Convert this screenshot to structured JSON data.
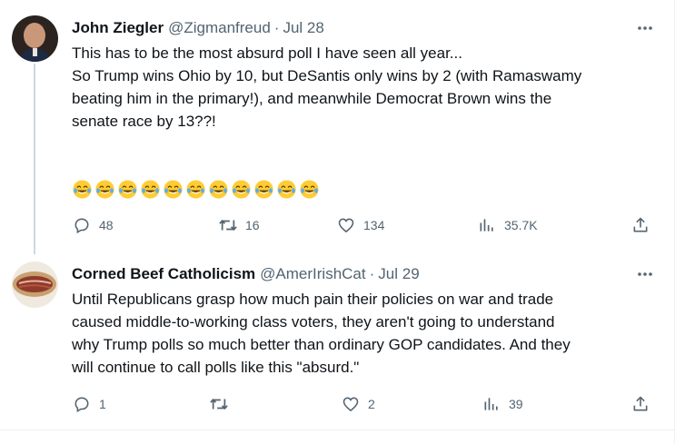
{
  "tweets": [
    {
      "name": "John Ziegler",
      "handle": "@Zigmanfreud",
      "sep": "·",
      "date": "Jul 28",
      "lines": [
        "This has to be the most absurd poll I have seen all year...",
        "",
        "So Trump wins Ohio by 10, but DeSantis only wins by 2 (with Ramaswamy",
        "beating him in the primary!), and meanwhile Democrat Brown wins the",
        "senate race by 13??!"
      ],
      "emoji": "face-with-tears-of-joy",
      "emoji_count": 11,
      "replies": "48",
      "retweets": "16",
      "likes": "134",
      "views": "35.7K"
    },
    {
      "name": "Corned Beef Catholicism",
      "handle": "@AmerIrishCat",
      "sep": "·",
      "date": "Jul 29",
      "lines": [
        "Until Republicans grasp how much pain their policies on war and trade",
        "caused middle-to-working class voters, they aren't going to understand",
        "why Trump polls so much better than ordinary GOP candidates. And they",
        "will continue to call polls like this \"absurd.\""
      ],
      "replies": "1",
      "retweets": "",
      "likes": "2",
      "views": "39"
    }
  ],
  "colors": {
    "text": "#0f1419",
    "secondary": "#536471",
    "border": "#eff3f4",
    "thread_line": "#cfd9de"
  },
  "icons": [
    "more-icon",
    "reply-icon",
    "retweet-icon",
    "like-icon",
    "views-icon",
    "share-icon"
  ]
}
